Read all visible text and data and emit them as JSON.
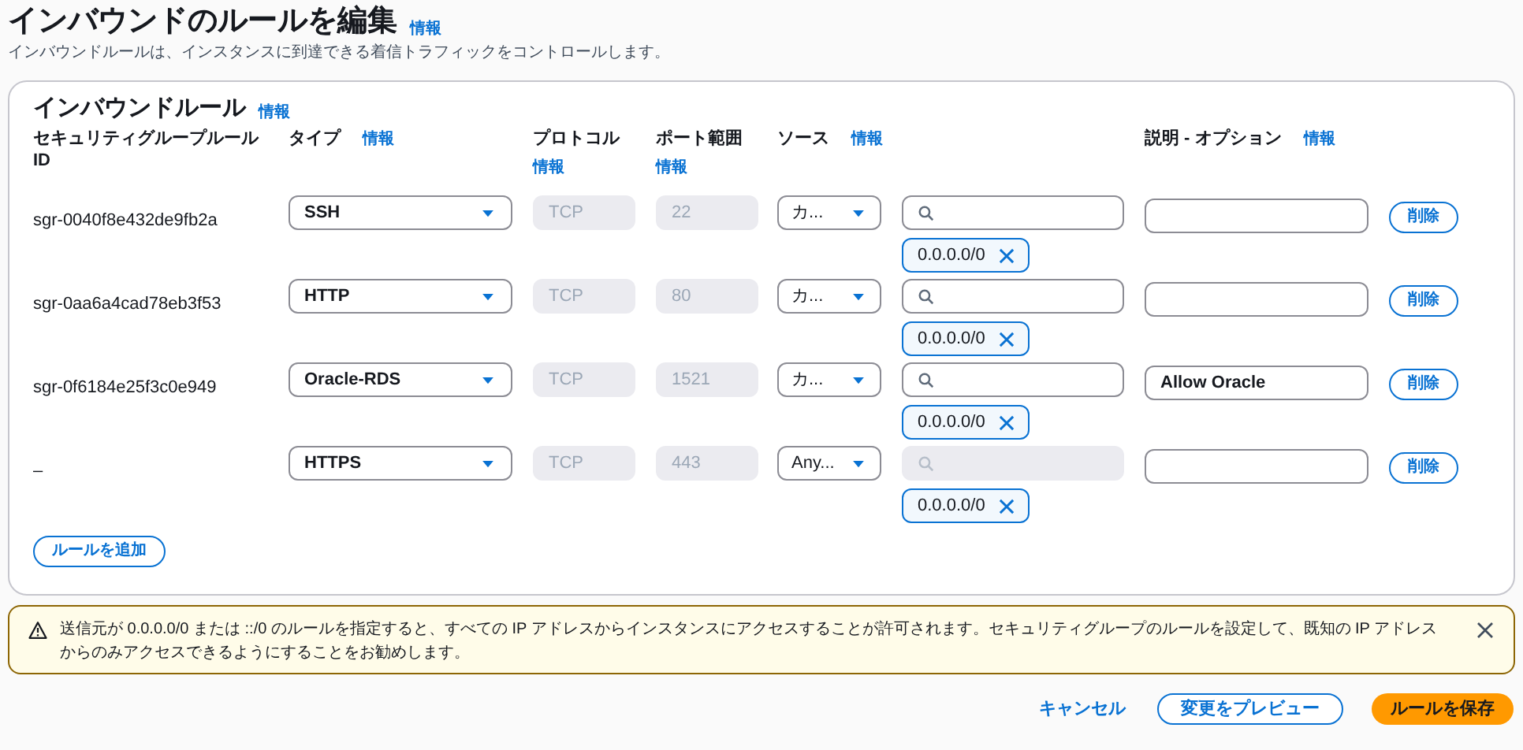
{
  "page": {
    "title": "インバウンドのルールを編集",
    "info_link": "情報",
    "description": "インバウンドルールは、インスタンスに到達できる着信トラフィックをコントロールします。"
  },
  "rules_panel": {
    "title": "インバウンドルール",
    "info_link": "情報",
    "columns": [
      {
        "label": "セキュリティグループルール ID"
      },
      {
        "label": "タイプ",
        "info_link": "情報",
        "kind": "inline"
      },
      {
        "label": "プロトコル",
        "info_link": "情報",
        "kind": "stacked"
      },
      {
        "label": "ポート範囲",
        "info_link": "情報",
        "kind": "stacked"
      },
      {
        "label": "ソース",
        "info_link": "情報",
        "kind": "inline"
      },
      {
        "label": "説明 - オプション",
        "info_link": "情報",
        "kind": "inline"
      }
    ],
    "rules": [
      {
        "id": "sgr-0040f8e432de9fb2a",
        "type": "SSH",
        "protocol": "TCP",
        "port": "22",
        "source": "カ...",
        "search_disabled": false,
        "cidr": "0.0.0.0/0",
        "delete_label": "削除"
      },
      {
        "id": "sgr-0aa6a4cad78eb3f53",
        "type": "HTTP",
        "protocol": "TCP",
        "port": "80",
        "source": "カ...",
        "search_disabled": false,
        "cidr": "0.0.0.0/0",
        "delete_label": "削除"
      },
      {
        "id": "sgr-0f6184e25f3c0e949",
        "type": "Oracle-RDS",
        "protocol": "TCP",
        "port": "1521",
        "source": "カ...",
        "search_disabled": false,
        "cidr": "0.0.0.0/0",
        "description": "Allow Oracle",
        "delete_label": "削除"
      },
      {
        "id": "–",
        "type": "HTTPS",
        "protocol": "TCP",
        "port": "443",
        "source": "Any...",
        "search_disabled": true,
        "cidr": "0.0.0.0/0",
        "delete_label": "削除"
      }
    ],
    "add_button": "ルールを追加"
  },
  "warning": {
    "text": "送信元が 0.0.0.0/0 または ::/0 のルールを指定すると、すべての IP アドレスからインスタンスにアクセスすることが許可されます。セキュリティグループのルールを設定して、既知の IP アドレスからのみアクセスできるようにすることをお勧めします。"
  },
  "footer": {
    "buttons": [
      {
        "label": "キャンセル",
        "kind": "link"
      },
      {
        "label": "変更をプレビュー",
        "kind": "secondary"
      },
      {
        "label": "ルールを保存",
        "kind": "primary"
      }
    ]
  }
}
